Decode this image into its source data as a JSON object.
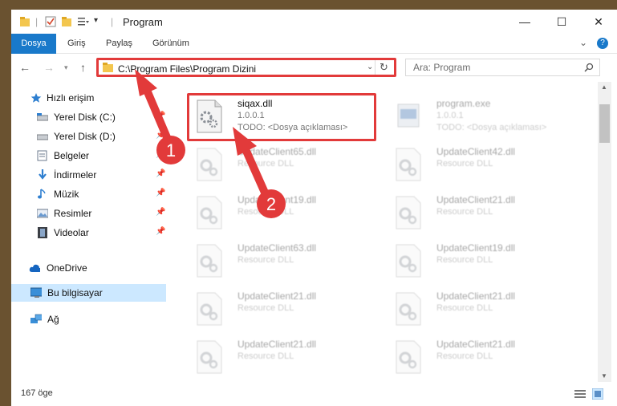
{
  "window": {
    "title": "Program",
    "controls": {
      "minimize": "—",
      "maximize": "☐",
      "close": "✕"
    }
  },
  "ribbon": {
    "tabs": [
      "Dosya",
      "Giriş",
      "Paylaş",
      "Görünüm"
    ],
    "expand_glyph": "⌄",
    "help_glyph": "?"
  },
  "address_bar": {
    "path": "C:\\Program Files\\Program Dizini"
  },
  "search": {
    "placeholder": "Ara: Program"
  },
  "nav_pane": {
    "items": [
      {
        "label": "Hızlı erişim",
        "icon": "star-icon"
      },
      {
        "label": "Yerel Disk (C:)",
        "icon": "drive-icon"
      },
      {
        "label": "Yerel Disk (D:)",
        "icon": "drive-icon"
      },
      {
        "label": "Belgeler",
        "icon": "documents-icon"
      },
      {
        "label": "İndirmeler",
        "icon": "download-icon"
      },
      {
        "label": "Müzik",
        "icon": "music-icon"
      },
      {
        "label": "Resimler",
        "icon": "pictures-icon"
      },
      {
        "label": "Videolar",
        "icon": "video-icon"
      },
      {
        "label": "OneDrive",
        "icon": "cloud-icon"
      },
      {
        "label": "Bu bilgisayar",
        "icon": "computer-icon"
      },
      {
        "label": "Ağ",
        "icon": "network-icon"
      }
    ]
  },
  "files": [
    {
      "name": "siqax.dll",
      "line1": "1.0.0.1",
      "line2": "TODO: <Dosya açıklaması>"
    },
    {
      "name": "program.exe",
      "line1": "1.0.0.1",
      "line2": "TODO: <Dosya açıklaması>"
    },
    {
      "name": "UpdateClient65.dll",
      "line1": "Resource DLL",
      "line2": ""
    },
    {
      "name": "UpdateClient42.dll",
      "line1": "Resource DLL",
      "line2": ""
    },
    {
      "name": "UpdateClient19.dll",
      "line1": "Resource DLL",
      "line2": ""
    },
    {
      "name": "UpdateClient21.dll",
      "line1": "Resource DLL",
      "line2": ""
    },
    {
      "name": "UpdateClient63.dll",
      "line1": "Resource DLL",
      "line2": ""
    },
    {
      "name": "UpdateClient19.dll",
      "line1": "Resource DLL",
      "line2": ""
    },
    {
      "name": "UpdateClient21.dll",
      "line1": "Resource DLL",
      "line2": ""
    },
    {
      "name": "UpdateClient21.dll",
      "line1": "Resource DLL",
      "line2": ""
    },
    {
      "name": "UpdateClient21.dll",
      "line1": "Resource DLL",
      "line2": ""
    },
    {
      "name": "UpdateClient21.dll",
      "line1": "Resource DLL",
      "line2": ""
    }
  ],
  "status_bar": {
    "item_count": "167 öge"
  },
  "annotations": {
    "step1": "1",
    "step2": "2",
    "accent": "#e23a3a"
  }
}
